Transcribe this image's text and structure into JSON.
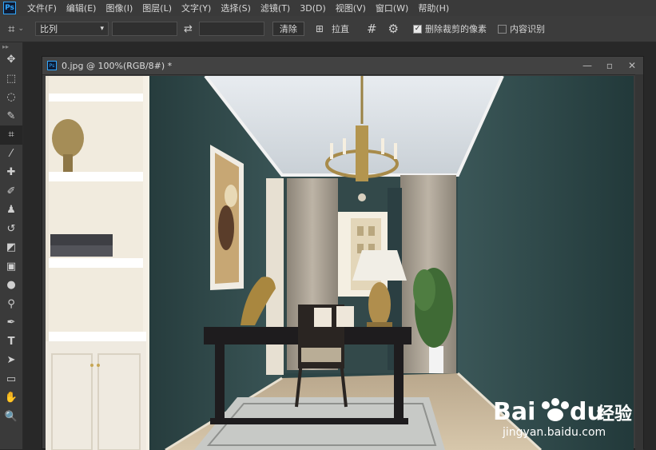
{
  "app": {
    "logo": "Ps"
  },
  "menu": [
    "文件(F)",
    "编辑(E)",
    "图像(I)",
    "图层(L)",
    "文字(Y)",
    "选择(S)",
    "滤镜(T)",
    "3D(D)",
    "视图(V)",
    "窗口(W)",
    "帮助(H)"
  ],
  "options": {
    "ratio_label": "比列",
    "clear_label": "清除",
    "straighten_label": "拉直",
    "delete_pixels_label": "删除裁剪的像素",
    "delete_pixels_checked": true,
    "content_aware_label": "内容识别",
    "content_aware_checked": false
  },
  "document": {
    "title": "0.jpg @ 100%(RGB/8#) *"
  },
  "watermark": {
    "brand": "Bai",
    "brand_suffix": "du",
    "product": "经验",
    "url": "jingyan.baidu.com"
  },
  "colors": {
    "accent": "#31a8ff",
    "wall": "#2f4a4a",
    "ceiling": "#dfe4ea"
  }
}
